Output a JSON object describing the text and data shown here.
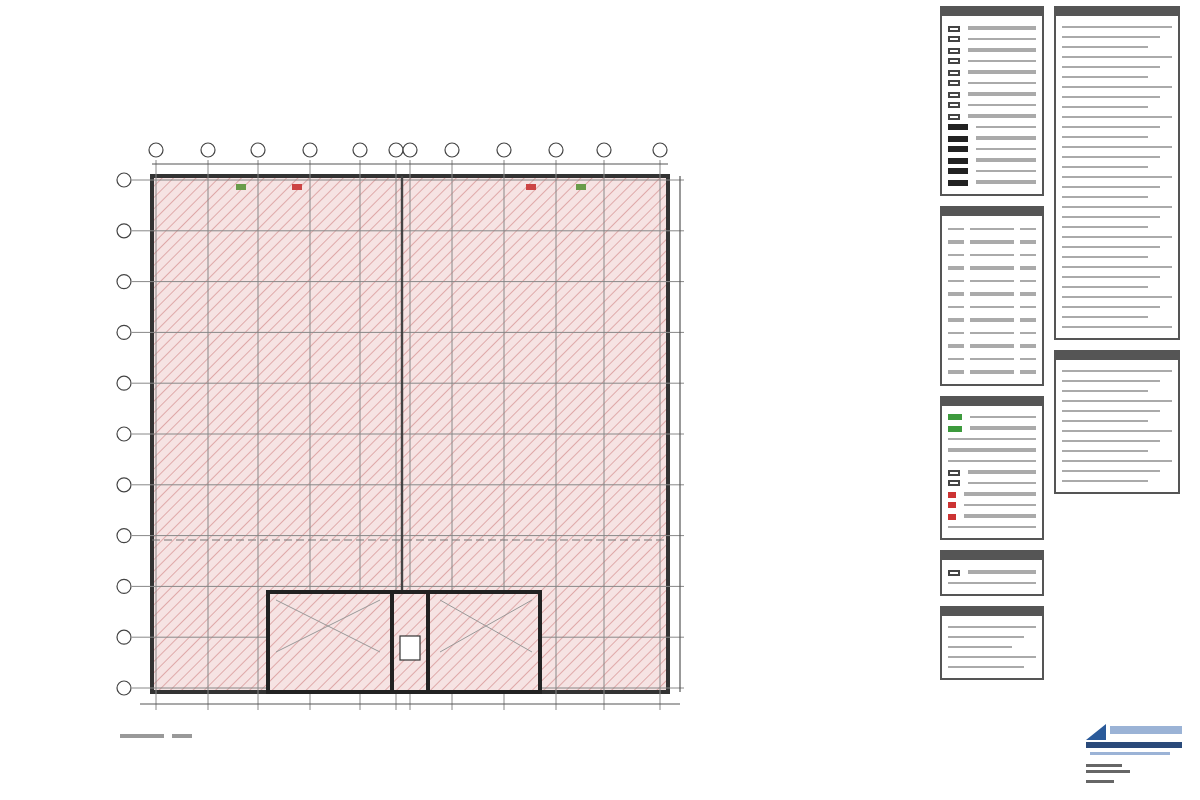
{
  "plan": {
    "hatched": true,
    "core_rooms": true,
    "axes": [
      {
        "kind": "column"
      },
      {
        "kind": "column"
      },
      {
        "kind": "column"
      },
      {
        "kind": "column"
      },
      {
        "kind": "column"
      },
      {
        "kind": "column"
      },
      {
        "kind": "column"
      },
      {
        "kind": "column"
      },
      {
        "kind": "column"
      },
      {
        "kind": "column"
      },
      {
        "kind": "column"
      },
      {
        "kind": "column"
      },
      {
        "kind": "row"
      },
      {
        "kind": "row"
      },
      {
        "kind": "row"
      },
      {
        "kind": "row"
      },
      {
        "kind": "row"
      },
      {
        "kind": "row"
      },
      {
        "kind": "row"
      },
      {
        "kind": "row"
      },
      {
        "kind": "row"
      },
      {
        "kind": "row"
      },
      {
        "kind": "row"
      }
    ]
  },
  "legend_columns": [
    {
      "panels": [
        {
          "kind": "symbols",
          "lines": [
            {
              "kind": "symbol"
            },
            {
              "kind": "symbol"
            },
            {
              "kind": "symbol"
            },
            {
              "kind": "symbol"
            },
            {
              "kind": "symbol"
            },
            {
              "kind": "symbol"
            },
            {
              "kind": "symbol"
            },
            {
              "kind": "symbol"
            },
            {
              "kind": "symbol"
            },
            {
              "kind": "bar"
            },
            {
              "kind": "bar"
            },
            {
              "kind": "bar"
            },
            {
              "kind": "bar"
            },
            {
              "kind": "bar"
            },
            {
              "kind": "bar"
            }
          ]
        },
        {
          "kind": "table",
          "lines": [
            {
              "kind": "row"
            },
            {
              "kind": "row"
            },
            {
              "kind": "row"
            },
            {
              "kind": "row"
            },
            {
              "kind": "row"
            },
            {
              "kind": "row"
            },
            {
              "kind": "row"
            },
            {
              "kind": "row"
            },
            {
              "kind": "row"
            },
            {
              "kind": "row"
            },
            {
              "kind": "row"
            },
            {
              "kind": "row"
            }
          ]
        },
        {
          "kind": "symbols",
          "lines": [
            {
              "kind": "green"
            },
            {
              "kind": "green"
            },
            {
              "kind": "text"
            },
            {
              "kind": "text"
            },
            {
              "kind": "text"
            },
            {
              "kind": "symbol"
            },
            {
              "kind": "symbol"
            },
            {
              "kind": "red"
            },
            {
              "kind": "red"
            },
            {
              "kind": "red"
            },
            {
              "kind": "text"
            }
          ]
        },
        {
          "kind": "symbols",
          "lines": [
            {
              "kind": "symbol"
            },
            {
              "kind": "text"
            }
          ]
        },
        {
          "kind": "notes",
          "lines": [
            {
              "kind": "text"
            },
            {
              "kind": "text"
            },
            {
              "kind": "text"
            },
            {
              "kind": "text"
            },
            {
              "kind": "text"
            }
          ]
        }
      ]
    },
    {
      "panels": [
        {
          "kind": "notes",
          "lines": [
            {
              "kind": "text"
            },
            {
              "kind": "text"
            },
            {
              "kind": "text"
            },
            {
              "kind": "text"
            },
            {
              "kind": "text"
            },
            {
              "kind": "text"
            },
            {
              "kind": "text"
            },
            {
              "kind": "text"
            },
            {
              "kind": "text"
            },
            {
              "kind": "text"
            },
            {
              "kind": "text"
            },
            {
              "kind": "text"
            },
            {
              "kind": "text"
            },
            {
              "kind": "text"
            },
            {
              "kind": "text"
            },
            {
              "kind": "text"
            },
            {
              "kind": "text"
            },
            {
              "kind": "text"
            },
            {
              "kind": "text"
            },
            {
              "kind": "text"
            },
            {
              "kind": "text"
            },
            {
              "kind": "text"
            },
            {
              "kind": "text"
            },
            {
              "kind": "text"
            },
            {
              "kind": "text"
            },
            {
              "kind": "text"
            },
            {
              "kind": "text"
            },
            {
              "kind": "text"
            },
            {
              "kind": "text"
            },
            {
              "kind": "text"
            },
            {
              "kind": "text"
            }
          ]
        },
        {
          "kind": "notes",
          "lines": [
            {
              "kind": "text"
            },
            {
              "kind": "text"
            },
            {
              "kind": "text"
            },
            {
              "kind": "text"
            },
            {
              "kind": "text"
            },
            {
              "kind": "text"
            },
            {
              "kind": "text"
            },
            {
              "kind": "text"
            },
            {
              "kind": "text"
            },
            {
              "kind": "text"
            },
            {
              "kind": "text"
            },
            {
              "kind": "text"
            }
          ]
        }
      ]
    }
  ]
}
